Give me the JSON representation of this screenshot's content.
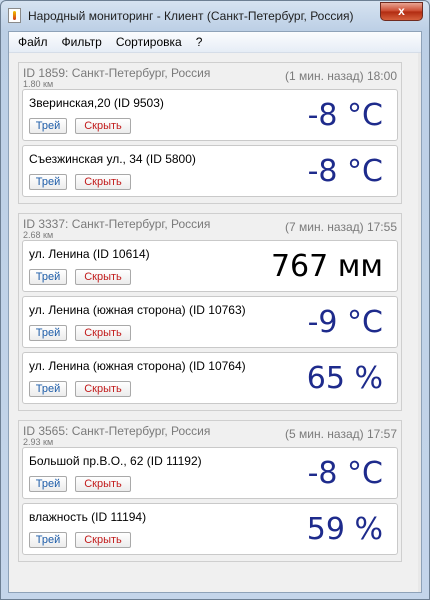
{
  "window": {
    "title": "Народный мониторинг - Клиент (Санкт-Петербург, Россия)",
    "close_label": "x"
  },
  "menu": {
    "file": "Файл",
    "filter": "Фильтр",
    "sort": "Сортировка",
    "help": "?"
  },
  "groups": [
    {
      "id_text": "ID 1859: Санкт-Петербург, Россия",
      "distance": "1.80 км",
      "time": "(1 мин. назад) 18:00",
      "sensors": [
        {
          "label": "Зверинская,20 (ID 9503)",
          "value": "-8 °C",
          "tray": "Трей",
          "hide": "Скрыть"
        },
        {
          "label": "Съезжинская ул., 34 (ID 5800)",
          "value": "-8 °C",
          "tray": "Трей",
          "hide": "Скрыть"
        }
      ]
    },
    {
      "id_text": "ID 3337: Санкт-Петербург, Россия",
      "distance": "2.68 км",
      "time": "(7 мин. назад) 17:55",
      "sensors": [
        {
          "label": "ул. Ленина (ID 10614)",
          "value": "767 мм",
          "tray": "Трей",
          "hide": "Скрыть"
        },
        {
          "label": "ул. Ленина (южная сторона) (ID 10763)",
          "value": "-9 °C",
          "tray": "Трей",
          "hide": "Скрыть"
        },
        {
          "label": "ул. Ленина (южная сторона) (ID 10764)",
          "value": "65 %",
          "tray": "Трей",
          "hide": "Скрыть"
        }
      ]
    },
    {
      "id_text": "ID 3565: Санкт-Петербург, Россия",
      "distance": "2.93 км",
      "time": "(5 мин. назад) 17:57",
      "sensors": [
        {
          "label": "Большой пр.В.О., 62 (ID 11192)",
          "value": "-8 °C",
          "tray": "Трей",
          "hide": "Скрыть"
        },
        {
          "label": "влажность (ID 11194)",
          "value": "59 %",
          "tray": "Трей",
          "hide": "Скрыть"
        }
      ]
    }
  ],
  "colors": {
    "value_blue": "#1e2b8c",
    "value_black": "#000000",
    "tray_text": "#1d5ca8",
    "hide_text": "#c21c1c"
  }
}
